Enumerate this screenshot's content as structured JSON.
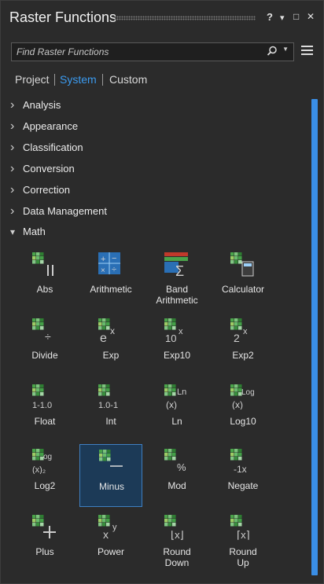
{
  "window": {
    "title": "Raster Functions",
    "help_label": "?",
    "menu_label": "▾",
    "restore_label": "□",
    "close_label": "✕"
  },
  "search": {
    "placeholder": "Find Raster Functions"
  },
  "tabs": [
    {
      "label": "Project",
      "active": false
    },
    {
      "label": "System",
      "active": true
    },
    {
      "label": "Custom",
      "active": false
    }
  ],
  "categories": [
    {
      "label": "Analysis",
      "expanded": false
    },
    {
      "label": "Appearance",
      "expanded": false
    },
    {
      "label": "Classification",
      "expanded": false
    },
    {
      "label": "Conversion",
      "expanded": false
    },
    {
      "label": "Correction",
      "expanded": false
    },
    {
      "label": "Data Management",
      "expanded": false
    },
    {
      "label": "Math",
      "expanded": true
    }
  ],
  "math_functions": [
    {
      "label": "Abs",
      "icon": "abs-icon",
      "glyph": "||"
    },
    {
      "label": "Arithmetic",
      "icon": "arithmetic-icon",
      "glyph": "+-"
    },
    {
      "label": "Band\nArithmetic",
      "icon": "band-arithmetic-icon",
      "glyph": "Σ"
    },
    {
      "label": "Calculator",
      "icon": "calculator-icon",
      "glyph": "calc"
    },
    {
      "label": "Divide",
      "icon": "divide-icon",
      "glyph": "÷"
    },
    {
      "label": "Exp",
      "icon": "exp-icon",
      "glyph": "eˣ"
    },
    {
      "label": "Exp10",
      "icon": "exp10-icon",
      "glyph": "10ˣ"
    },
    {
      "label": "Exp2",
      "icon": "exp2-icon",
      "glyph": "2ˣ"
    },
    {
      "label": "Float",
      "icon": "float-icon",
      "glyph": "1-1.0"
    },
    {
      "label": "Int",
      "icon": "int-icon",
      "glyph": "1.0-1"
    },
    {
      "label": "Ln",
      "icon": "ln-icon",
      "glyph": "Ln"
    },
    {
      "label": "Log10",
      "icon": "log10-icon",
      "glyph": "Log"
    },
    {
      "label": "Log2",
      "icon": "log2-icon",
      "glyph": "log2"
    },
    {
      "label": "Minus",
      "icon": "minus-icon",
      "glyph": "—",
      "selected": true
    },
    {
      "label": "Mod",
      "icon": "mod-icon",
      "glyph": "%"
    },
    {
      "label": "Negate",
      "icon": "negate-icon",
      "glyph": "-1x"
    },
    {
      "label": "Plus",
      "icon": "plus-icon",
      "glyph": "+"
    },
    {
      "label": "Power",
      "icon": "power-icon",
      "glyph": "xʸ"
    },
    {
      "label": "Round\nDown",
      "icon": "round-down-icon",
      "glyph": "⌊x⌋"
    },
    {
      "label": "Round\nUp",
      "icon": "round-up-icon",
      "glyph": "⌈x⌉"
    }
  ],
  "colors": {
    "accent": "#3b9bf0",
    "background": "#2b2b2b",
    "selected_tile": "#1c3a57"
  }
}
